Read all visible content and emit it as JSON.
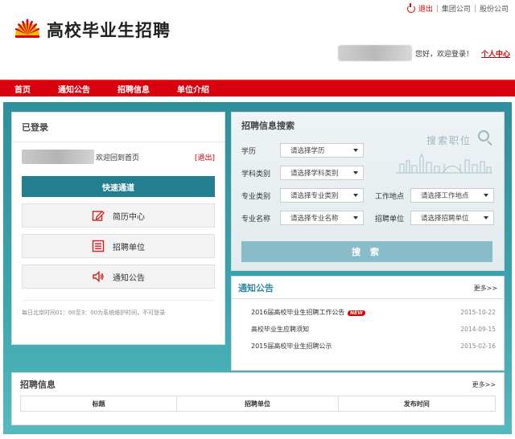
{
  "top_links": {
    "logout": "退出",
    "group": "集团公司",
    "sep": "|",
    "company": "股份公司"
  },
  "logo": {
    "title": "高校毕业生招聘"
  },
  "welcome": {
    "text": "您好，欢迎登录！",
    "personal_center": "个人中心"
  },
  "nav": {
    "items": [
      "首页",
      "通知公告",
      "招聘信息",
      "单位介绍"
    ]
  },
  "login_panel": {
    "title": "已登录",
    "welcome_back": "欢迎回到首页",
    "logout": "[退出]",
    "quick_channel": "快速通道",
    "menu": [
      {
        "label": "简历中心",
        "icon": "edit-icon"
      },
      {
        "label": "招聘单位",
        "icon": "list-icon"
      },
      {
        "label": "通知公告",
        "icon": "speaker-icon"
      }
    ],
    "maintenance": "每日北京时间01：00至3：00为系统维护时间，不可登录"
  },
  "search": {
    "title": "招聘信息搜索",
    "deco_text": "搜索职位",
    "fields": {
      "education": {
        "label": "学历",
        "placeholder": "请选择学历"
      },
      "discipline": {
        "label": "学科类别",
        "placeholder": "请选择学科类别"
      },
      "major_category": {
        "label": "专业类别",
        "placeholder": "请选择专业类别"
      },
      "work_location": {
        "label": "工作地点",
        "placeholder": "请选择工作地点"
      },
      "major_name": {
        "label": "专业名称",
        "placeholder": "请选择专业名称"
      },
      "employer": {
        "label": "招聘单位",
        "placeholder": "请选择招聘单位"
      }
    },
    "button": "搜 索"
  },
  "notices": {
    "title": "通知公告",
    "more": "更多>>",
    "new_badge": "NEW",
    "items": [
      {
        "title": "2016届高校毕业生招聘工作公告",
        "date": "2015-10-22",
        "is_new": true
      },
      {
        "title": "高校毕业生应聘须知",
        "date": "2014-09-15",
        "is_new": false
      },
      {
        "title": "2015届高校毕业生招聘公示",
        "date": "2015-02-16",
        "is_new": false
      }
    ]
  },
  "jobs": {
    "title": "招聘信息",
    "more": "更多>>",
    "columns": [
      "标题",
      "招聘单位",
      "发布时间"
    ]
  },
  "colors": {
    "brand_red": "#d6000e",
    "teal": "#237f90",
    "accent_red": "#cc0000"
  }
}
